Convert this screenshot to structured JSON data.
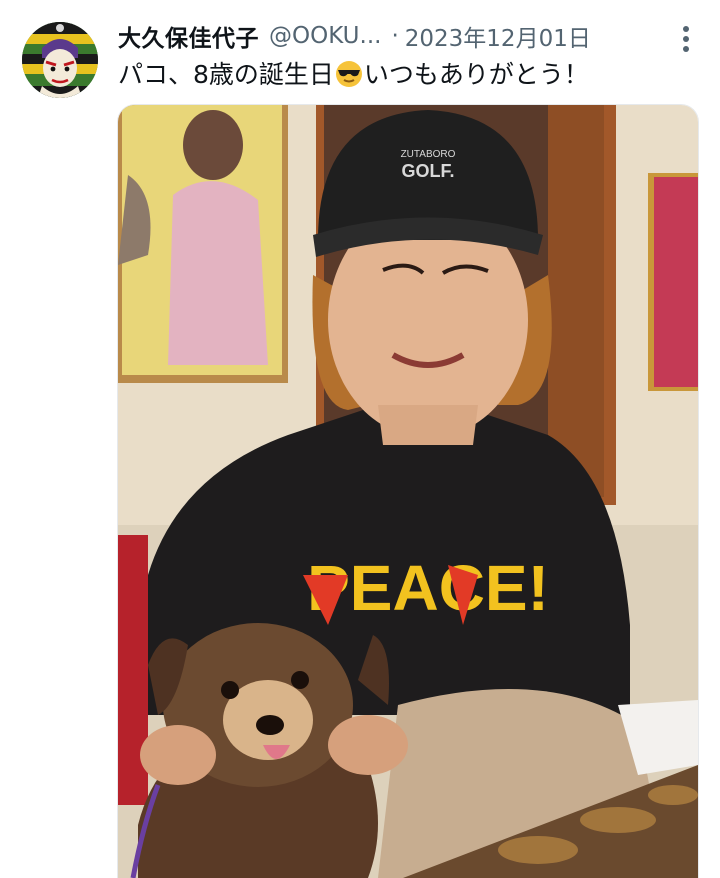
{
  "tweet": {
    "display_name": "大久保佳代子",
    "handle": "@OOKU...",
    "separator": "·",
    "date": "2023年12月01日",
    "text_before_emoji": "パコ、8歳の誕生日",
    "emoji_icon": "sunglasses-emoji",
    "text_after_emoji": "いつもありがとう！"
  },
  "photo": {
    "cap_text_line1": "ZUTABORO",
    "cap_text_line2": "GOLF.",
    "shirt_text": "PEACE!",
    "subjects": [
      "woman-in-black-cap",
      "small-brown-dog"
    ]
  },
  "colors": {
    "name": "#0f1419",
    "secondary": "#536471",
    "photo_wall": "#e9ddc8",
    "shirt": "#1e1c1d",
    "shirt_print_yellow": "#f2c21f",
    "shirt_print_red": "#e23a26"
  }
}
